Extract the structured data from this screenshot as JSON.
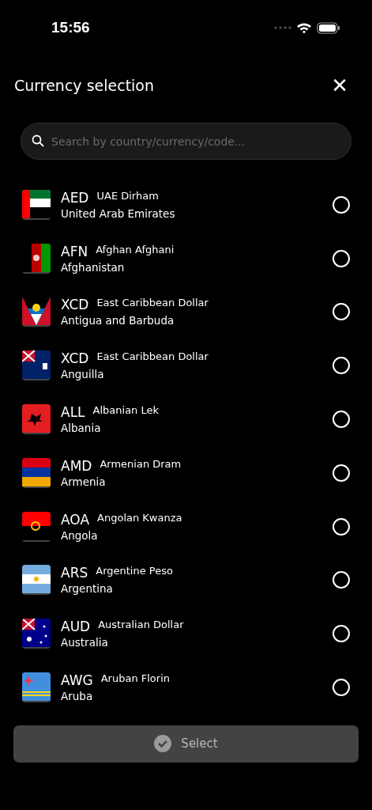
{
  "status_bar": {
    "time": "15:56"
  },
  "header": {
    "title": "Currency selection",
    "close": "✕"
  },
  "search": {
    "placeholder": "Search by country/currency/code..."
  },
  "currencies": [
    {
      "code": "AED",
      "name": "UAE Dirham",
      "country": "United Arab Emirates",
      "selected": false
    },
    {
      "code": "AFN",
      "name": "Afghan Afghani",
      "country": "Afghanistan",
      "selected": false
    },
    {
      "code": "XCD",
      "name": "East Caribbean Dollar",
      "country": "Antigua and Barbuda",
      "selected": false
    },
    {
      "code": "XCD",
      "name": "East Caribbean Dollar",
      "country": "Anguilla",
      "selected": false
    },
    {
      "code": "ALL",
      "name": "Albanian Lek",
      "country": "Albania",
      "selected": false
    },
    {
      "code": "AMD",
      "name": "Armenian Dram",
      "country": "Armenia",
      "selected": false
    },
    {
      "code": "AOA",
      "name": "Angolan Kwanza",
      "country": "Angola",
      "selected": false
    },
    {
      "code": "ARS",
      "name": "Argentine Peso",
      "country": "Argentina",
      "selected": false
    },
    {
      "code": "AUD",
      "name": "Australian Dollar",
      "country": "Australia",
      "selected": false
    },
    {
      "code": "AWG",
      "name": "Aruban Florin",
      "country": "Aruba",
      "selected": false
    }
  ],
  "select_button": {
    "label": "Select",
    "disabled": true
  }
}
